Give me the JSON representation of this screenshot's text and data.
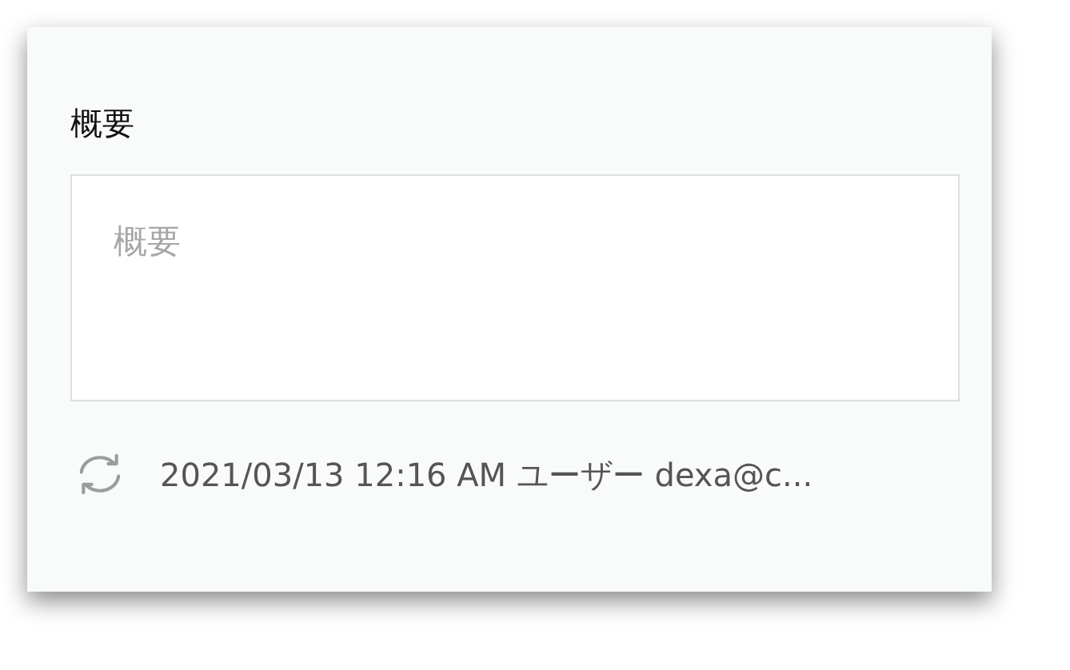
{
  "section": {
    "title": "概要"
  },
  "summary_field": {
    "placeholder": "概要"
  },
  "footer": {
    "text": "2021/03/13 12:16 AM ユーザー dexa@c..."
  }
}
